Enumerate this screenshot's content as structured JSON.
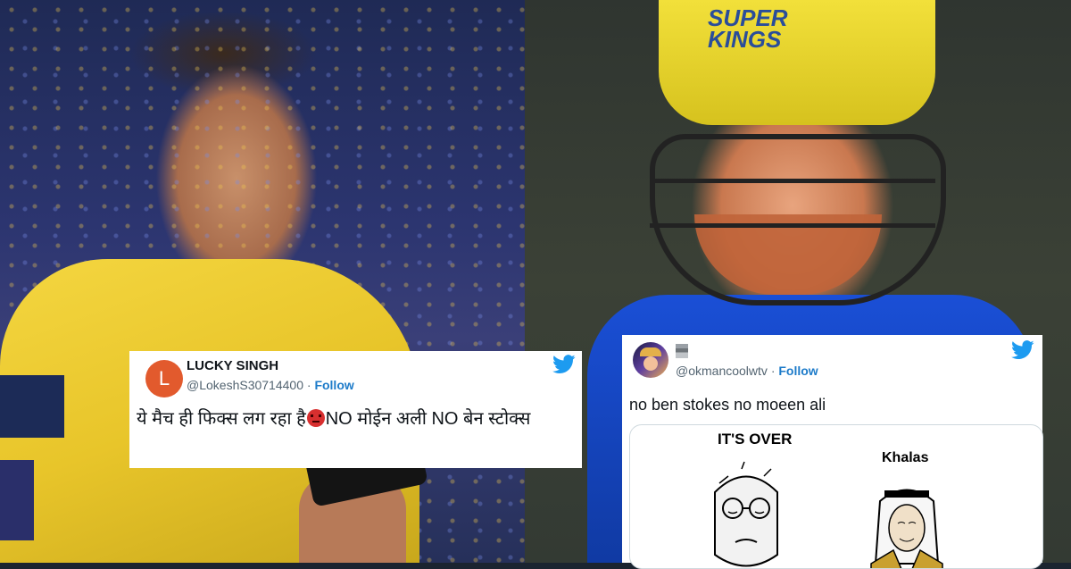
{
  "tweet_lucky": {
    "avatar_letter": "L",
    "name": "LUCKY SINGH",
    "handle": "@LokeshS30714400",
    "separator": "·",
    "follow": "Follow",
    "text_part1": "ये मैच ही फिक्स लग रहा है",
    "text_part2": "NO मोईन अली NO बेन स्टोक्स",
    "emoji_icon": "angry-face-icon"
  },
  "tweet_ok": {
    "handle": "@okmancoolwtv",
    "separator": "·",
    "follow": "Follow",
    "text": "no ben stokes no moeen ali",
    "meme_title_left": "IT'S OVER",
    "meme_title_right": "Khalas"
  },
  "photo_right": {
    "helmet_line1": "SUPER",
    "helmet_line2": "KINGS"
  },
  "colors": {
    "twitter_blue": "#1d9bf0",
    "follow_blue": "#1d7bc9",
    "csk_yellow": "#f4d640"
  }
}
